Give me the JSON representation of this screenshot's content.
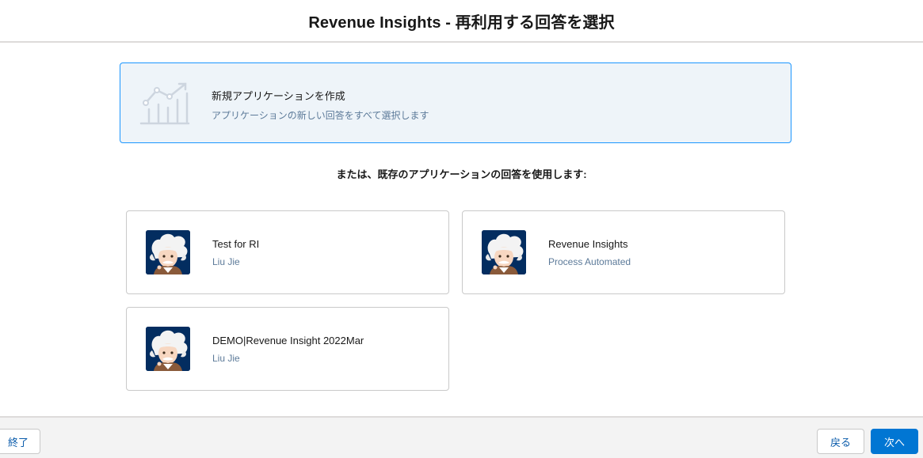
{
  "header": {
    "title": "Revenue Insights - 再利用する回答を選択"
  },
  "new_app": {
    "icon": "line-chart-icon",
    "title": "新規アプリケーションを作成",
    "subtitle": "アプリケーションの新しい回答をすべて選択します"
  },
  "divider_text": "または、既存のアプリケーションの回答を使用します:",
  "apps": [
    {
      "name": "Test for RI",
      "owner": "Liu Jie",
      "avatar": "einstein-avatar"
    },
    {
      "name": "Revenue Insights",
      "owner": "Process Automated",
      "avatar": "einstein-avatar"
    },
    {
      "name": "DEMO|Revenue Insight 2022Mar",
      "owner": "Liu Jie",
      "avatar": "einstein-avatar"
    }
  ],
  "footer": {
    "end_label": "終了",
    "back_label": "戻る",
    "next_label": "次へ"
  },
  "colors": {
    "accent": "#0176d3",
    "card_border_selected": "#1b96ff",
    "card_bg_selected": "#eef4f9",
    "secondary_text": "#5c7a99",
    "avatar_bg": "#032d60"
  }
}
